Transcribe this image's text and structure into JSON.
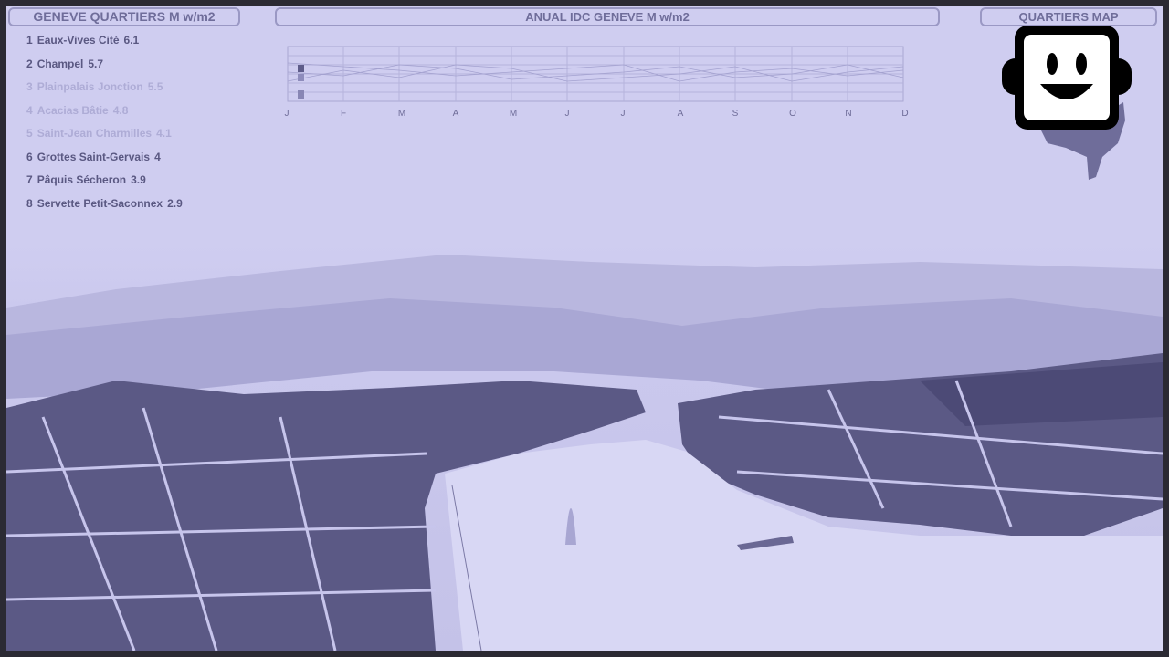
{
  "quartiers": {
    "title": "GENEVE QUARTIERS   M w/m2",
    "items": [
      {
        "rank": "1",
        "name": "Eaux-Vives Cité",
        "value": "6.1",
        "style": "dark"
      },
      {
        "rank": "2",
        "name": "Champel",
        "value": "5.7",
        "style": "dark"
      },
      {
        "rank": "3",
        "name": "Plainpalais Jonction",
        "value": "5.5",
        "style": "light"
      },
      {
        "rank": "4",
        "name": "Acacias Bâtie",
        "value": "4.8",
        "style": "light"
      },
      {
        "rank": "5",
        "name": "Saint-Jean Charmilles",
        "value": "4.1",
        "style": "light"
      },
      {
        "rank": "6",
        "name": "Grottes Saint-Gervais",
        "value": "4",
        "style": "dark"
      },
      {
        "rank": "7",
        "name": "Pâquis Sécheron",
        "value": "3.9",
        "style": "dark"
      },
      {
        "rank": "8",
        "name": "Servette Petit-Saconnex",
        "value": "2.9",
        "style": "dark"
      }
    ]
  },
  "annual": {
    "title": "ANUAL IDC GENEVE   M w/m2",
    "months": [
      "J",
      "F",
      "M",
      "A",
      "M",
      "J",
      "J",
      "A",
      "S",
      "O",
      "N",
      "D"
    ]
  },
  "map": {
    "title": "QUARTIERS MAP",
    "logo_icon": "smiley-face-icon"
  },
  "colors": {
    "background": "#cfcdf0",
    "panel_border": "#9a98c4",
    "text_dark": "#5a5882",
    "text_light": "#aeacd6",
    "buildings": "#55537e"
  }
}
